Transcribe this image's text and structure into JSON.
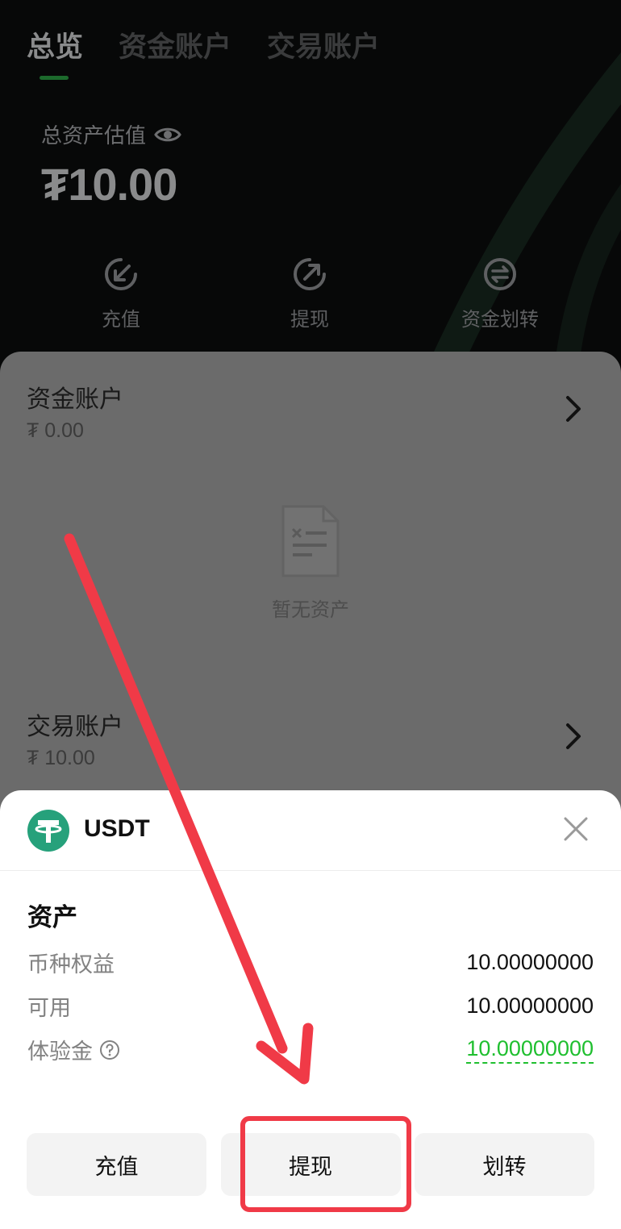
{
  "header": {
    "tabs": [
      {
        "label": "总览",
        "active": true
      },
      {
        "label": "资金账户",
        "active": false
      },
      {
        "label": "交易账户",
        "active": false
      }
    ],
    "total_label": "总资产估值",
    "total_value": "₮10.00",
    "actions": [
      {
        "label": "充值",
        "icon": "deposit-icon"
      },
      {
        "label": "提现",
        "icon": "withdraw-icon"
      },
      {
        "label": "资金划转",
        "icon": "transfer-icon"
      }
    ]
  },
  "accounts": {
    "funding": {
      "name": "资金账户",
      "value": "₮ 0.00"
    },
    "empty_text": "暂无资产",
    "trading": {
      "name": "交易账户",
      "value": "₮ 10.00"
    }
  },
  "sheet": {
    "coin": "USDT",
    "section_title": "资产",
    "rows": [
      {
        "label": "币种权益",
        "value": "10.00000000"
      },
      {
        "label": "可用",
        "value": "10.00000000"
      },
      {
        "label": "体验金",
        "value": "10.00000000"
      }
    ],
    "buttons": {
      "deposit": "充值",
      "withdraw": "提现",
      "transfer": "划转"
    }
  },
  "colors": {
    "accent_green": "#1fbf2f",
    "tether_green": "#26a17b",
    "annotation_red": "#f03a47"
  }
}
